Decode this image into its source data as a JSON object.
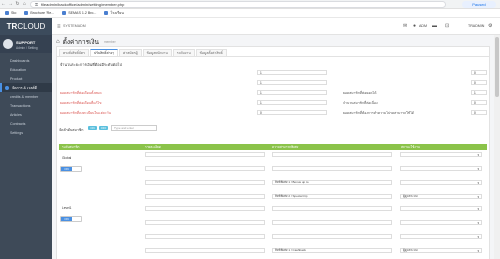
{
  "browser": {
    "url": "fileadmin/backoffice/admin/setting/member.php",
    "paused_label": "Paused",
    "bookmarks": [
      "Sto",
      "Brochure 'Re...",
      "SEMAS 1.2 Bro...",
      "โรงเรียน"
    ]
  },
  "header": {
    "logo_tr": "TR",
    "logo_cloud": "CLOUD",
    "menu_label": "SYSTEMADM",
    "user_short": "ADM",
    "right_text": "TRADMIN"
  },
  "sidebar": {
    "user_name": "SUPPORT",
    "user_sub": "Admin / Setting",
    "items": [
      {
        "label": "Dashboards"
      },
      {
        "label": "Education"
      },
      {
        "label": "Product"
      },
      {
        "label": "จัดการ & เวลส์ดี"
      },
      {
        "label": "credits & member"
      },
      {
        "label": "Transactions"
      },
      {
        "label": "Articles"
      },
      {
        "label": "Contracts"
      },
      {
        "label": "Settings"
      }
    ]
  },
  "page": {
    "title": "ตั้งค่าการเงิน",
    "subtitle": "member",
    "tabs": [
      "ตรงสั่งสิทธิ์บัตร",
      "ปรับสิทธิ์ต่างๆ",
      "ค่าสมัครผู้",
      "ข้อมูลพนักงาน",
      "ระดับงาน",
      "ข้อมูลตั้งค่าสิทธิ์"
    ]
  },
  "settings": {
    "section_title": "จำนวนระยะการเงินที่ต้องมีระดับต่อไป",
    "rows": [
      {
        "left_label": "",
        "left_value": "1",
        "right_label": "",
        "right_value": "0"
      },
      {
        "left_label": "",
        "left_value": "1",
        "right_label": "",
        "right_value": "0"
      },
      {
        "left_label": "ยอดสมาชิกที่ต่อเดือนทั้งหมด",
        "left_value": "1",
        "right_label": "ยอดสมาชิกที่ต่อยอดได้",
        "right_value": "1"
      },
      {
        "left_label": "ยอดสมาชิกที่ต่อเดือนที่แก้ไข",
        "left_value": "1",
        "right_label": "จำนวนสมาชิกที่ต่อเนื่อง",
        "right_value": "0"
      },
      {
        "left_label": "ยอดสมาชิกที่ลงทะเบียนในแต่ละวัน",
        "left_value": "0",
        "right_label": "ยอดสมาชิกที่ต้องการทำความโปรดสามารถใช้ได้",
        "right_value": "0"
      }
    ]
  },
  "rank": {
    "label": "จัดลำดับสมาชิก",
    "btn_a": "ON",
    "btn_b": "OFF",
    "search_placeholder": "Type and enter"
  },
  "table": {
    "headers": [
      "ระดับสมาชิก",
      "รายละเอียด",
      "ความสามารถพิเศษ",
      "สถานะใช้งาน"
    ],
    "groups": [
      {
        "name": "Global",
        "toggle": "ON",
        "rows": [
          {
            "c1": "",
            "c2": "",
            "c3": "",
            "c4": ""
          },
          {
            "c1": "",
            "c2": "",
            "c3": "",
            "c4": ""
          },
          {
            "c1": "",
            "c2": "",
            "c3": "สิทธิพิเศษ 1 / Bonus up to",
            "c4": ""
          },
          {
            "c1": "",
            "c2": "",
            "c3": "สิทธิพิเศษ 2 / Special trip",
            "c4": "ผู้ดูแลระบบ"
          }
        ]
      },
      {
        "name": "Level1",
        "toggle": "ON",
        "rows": [
          {
            "c1": "",
            "c2": "",
            "c3": "",
            "c4": ""
          },
          {
            "c1": "",
            "c2": "",
            "c3": "",
            "c4": ""
          },
          {
            "c1": "",
            "c2": "",
            "c3": "",
            "c4": ""
          },
          {
            "c1": "",
            "c2": "",
            "c3": "สิทธิพิเศษ 1 / Cashback",
            "c4": "ผู้ดูแลระบบ"
          }
        ]
      }
    ]
  }
}
